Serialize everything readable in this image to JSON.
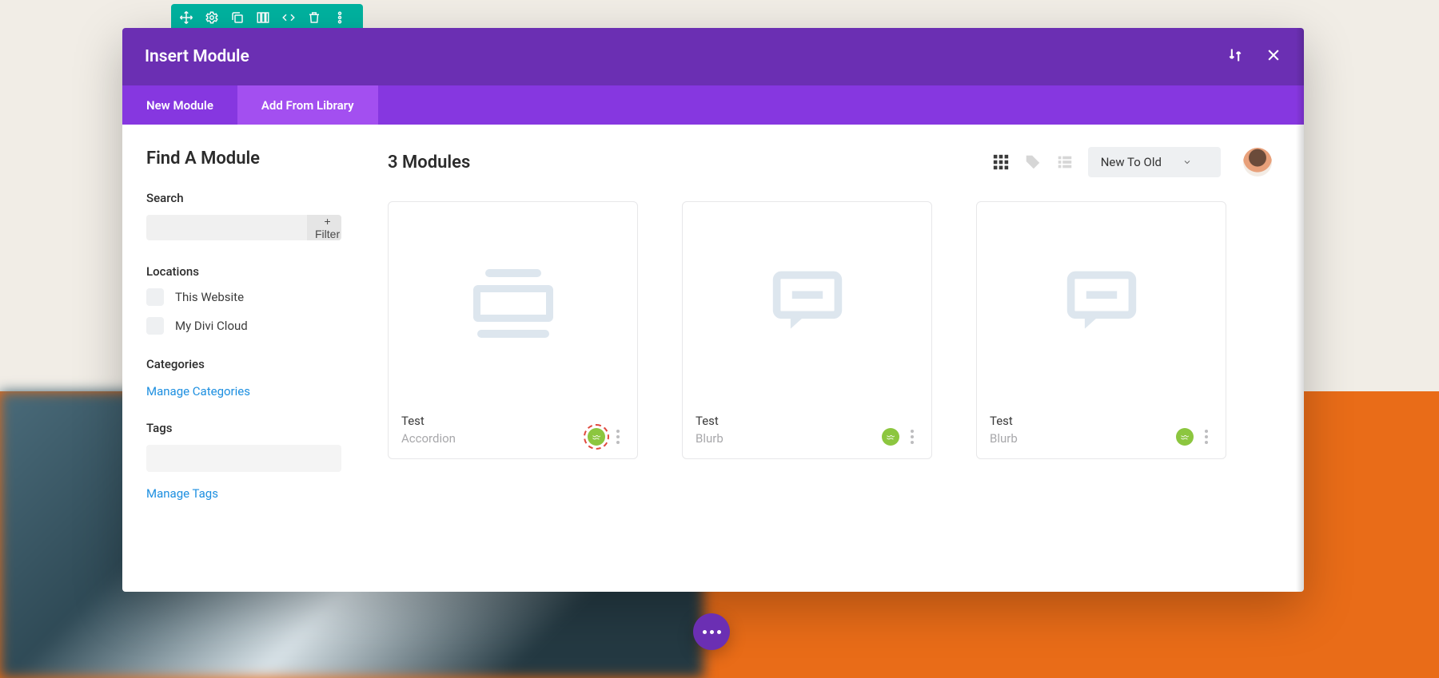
{
  "modal": {
    "title": "Insert Module",
    "tabs": {
      "new": "New Module",
      "library": "Add From Library"
    }
  },
  "sidebar": {
    "heading": "Find A Module",
    "search_label": "Search",
    "search_value": "",
    "search_placeholder": "",
    "filter_btn": "+ Filter",
    "locations_label": "Locations",
    "locations": [
      {
        "label": "This Website"
      },
      {
        "label": "My Divi Cloud"
      }
    ],
    "categories_label": "Categories",
    "manage_categories": "Manage Categories",
    "tags_label": "Tags",
    "manage_tags": "Manage Tags"
  },
  "content": {
    "count_heading": "3 Modules",
    "sort_value": "New To Old",
    "cards": [
      {
        "name": "Test",
        "type": "Accordion",
        "icon": "accordion",
        "highlight": true
      },
      {
        "name": "Test",
        "type": "Blurb",
        "icon": "blurb",
        "highlight": false
      },
      {
        "name": "Test",
        "type": "Blurb",
        "icon": "blurb",
        "highlight": false
      }
    ]
  }
}
